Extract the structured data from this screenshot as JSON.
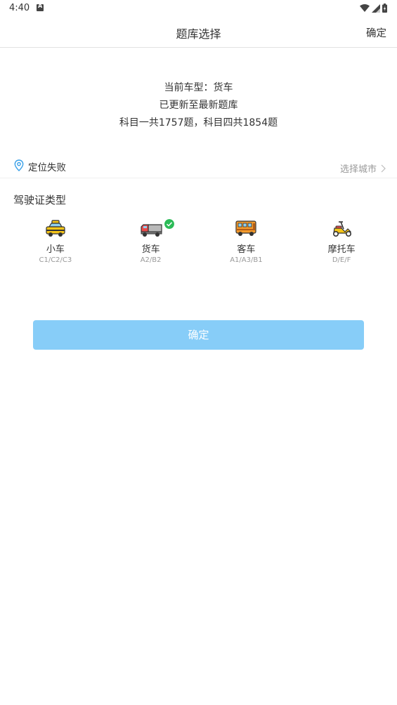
{
  "status_bar": {
    "time": "4:40"
  },
  "header": {
    "title": "题库选择",
    "confirm_label": "确定"
  },
  "info": {
    "line1": "当前车型：货车",
    "line2": "已更新至最新题库",
    "line3": "科目一共1757题，科目四共1854题"
  },
  "location": {
    "status": "定位失败",
    "select_city_label": "选择城市"
  },
  "license_section": {
    "title": "驾驶证类型",
    "selected": "货车",
    "types": [
      {
        "name": "小车",
        "code": "C1/C2/C3",
        "icon": "car-icon"
      },
      {
        "name": "货车",
        "code": "A2/B2",
        "icon": "truck-icon"
      },
      {
        "name": "客车",
        "code": "A1/A3/B1",
        "icon": "bus-icon"
      },
      {
        "name": "摩托车",
        "code": "D/E/F",
        "icon": "motorcycle-icon"
      }
    ]
  },
  "confirm_button_label": "确定",
  "colors": {
    "accent": "#87cdf8",
    "check": "#2bbb57",
    "muted": "#999999"
  }
}
